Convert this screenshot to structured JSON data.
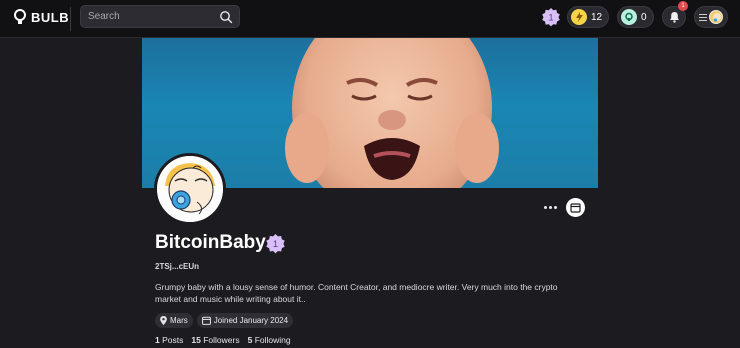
{
  "nav": {
    "logo_text": "BULB",
    "search_placeholder": "Search",
    "level_value": "1",
    "points": "12",
    "tokens": "0",
    "notifications": "1"
  },
  "profile": {
    "name": "BitcoinBaby",
    "level": "1",
    "wallet": "2TSj...cEUn",
    "bio": "Grumpy baby with a lousy sense of humor. Content Creator, and mediocre writer. Very much into the crypto market and music while writing about it..",
    "location": "Mars",
    "joined": "Joined January 2024",
    "posts_count": "1",
    "posts_label": "Posts",
    "followers_count": "15",
    "followers_label": "Followers",
    "following_count": "5",
    "following_label": "Following"
  },
  "colors": {
    "background": "#1c1b20",
    "topbar": "#111114",
    "level_badge": "#c9a8f0",
    "points_badge": "#f5d547",
    "token_badge": "#7fe3c4",
    "notification": "#e5484d"
  },
  "icons": [
    "bulb-logo-icon",
    "search-icon",
    "level-badge-icon",
    "lightning-icon",
    "token-icon",
    "bell-icon",
    "menu-icon",
    "more-options-icon",
    "calendar-icon",
    "location-pin-icon"
  ]
}
